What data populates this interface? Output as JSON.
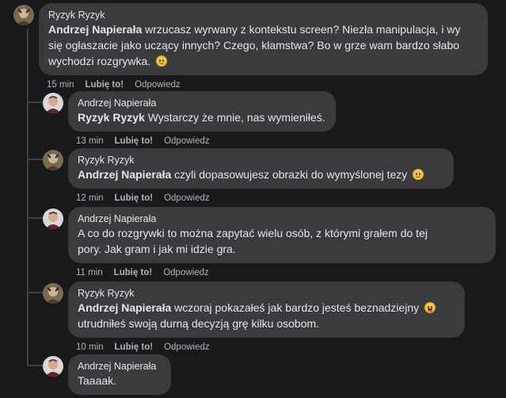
{
  "comments": [
    {
      "author": "Ryzyk Ryzyk",
      "mention": "Andrzej Napierała",
      "text_lines": [
        " wrzucasz wyrwany z kontekstu screen? Niezła manipulacja, i wy",
        "się ogłaszacie jako uczący innych? Czego, kłamstwa? Bo w grze wam bardzo słabo",
        "wychodzi rozgrywka."
      ],
      "emoji": "smile",
      "time": "15 min",
      "like": "Lubię to!",
      "reply": "Odpowiedz"
    },
    {
      "author": "Andrzej Napierała",
      "mention": "Ryzyk Ryzyk",
      "text_lines": [
        " Wystarczy że mnie, nas wymieniłeś."
      ],
      "time": "13 min",
      "like": "Lubię to!",
      "reply": "Odpowiedz"
    },
    {
      "author": "Ryzyk Ryzyk",
      "mention": "Andrzej Napierała",
      "text_lines": [
        " czyli dopasowujesz obrazki do wymyślonej tezy"
      ],
      "emoji": "smile",
      "time": "12 min",
      "like": "Lubię to!",
      "reply": "Odpowiedz"
    },
    {
      "author": "Andrzej Napierała",
      "text_lines": [
        "A co do rozgrywki to można zapytać wielu osób, z którymi grałem do tej",
        "pory. Jak gram i jak mi idzie gra."
      ],
      "time": "11 min",
      "like": "Lubię to!",
      "reply": "Odpowiedz"
    },
    {
      "author": "Ryzyk Ryzyk",
      "mention": "Andrzej Napierała",
      "text_lines": [
        " wczoraj pokazałeś jak bardzo jesteś beznadziejny",
        "utrudniłeś swoją durną decyzją grę kilku osobom."
      ],
      "emoji": "tongue",
      "time": "10 min",
      "like": "Lubię to!",
      "reply": "Odpowiedz"
    },
    {
      "author": "Andrzej Napierała",
      "text_lines": [
        "Taaaak."
      ]
    }
  ],
  "colors": {
    "background": "#18191a",
    "bubble": "#3a3b3c",
    "text": "#e4e6eb",
    "meta": "#b0b3b8"
  }
}
